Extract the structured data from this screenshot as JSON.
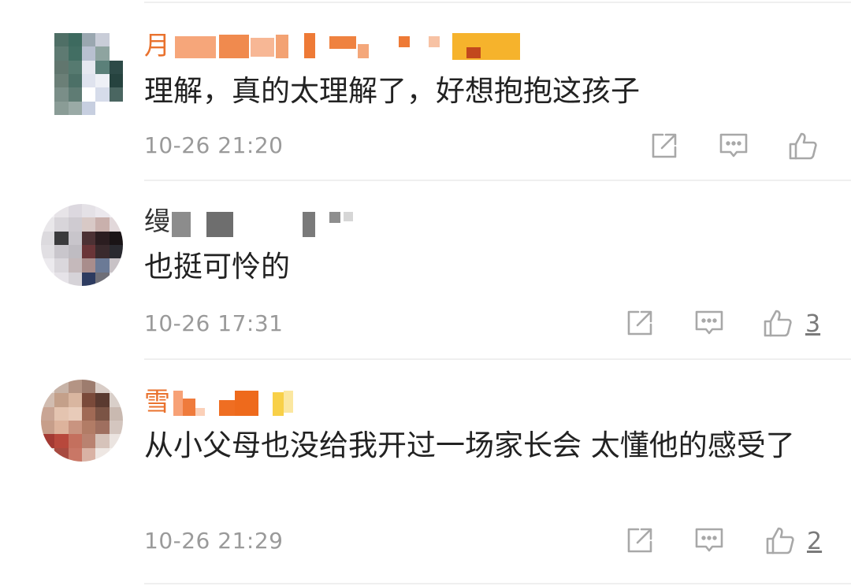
{
  "comments": [
    {
      "username_visible": "月",
      "text": "理解，真的太理解了，好想抱抱这孩子",
      "time": "10-26 21:20",
      "likes": "",
      "icons": {
        "share": "share-icon",
        "reply": "comment-icon",
        "like": "thumbs-up-icon"
      }
    },
    {
      "username_visible": "缦",
      "text": "也挺可怜的",
      "time": "10-26 17:31",
      "likes": "3",
      "icons": {
        "share": "share-icon",
        "reply": "comment-icon",
        "like": "thumbs-up-icon"
      }
    },
    {
      "username_visible": "雪",
      "text": "从小父母也没给我开过一场家长会 太懂他的感受了",
      "time": "10-26 21:29",
      "likes": "2",
      "icons": {
        "share": "share-icon",
        "reply": "comment-icon",
        "like": "thumbs-up-icon"
      }
    }
  ],
  "colors": {
    "username": "#e9722e",
    "text": "#222222",
    "meta": "#9a9a9a",
    "icon": "#a8a8a8"
  }
}
